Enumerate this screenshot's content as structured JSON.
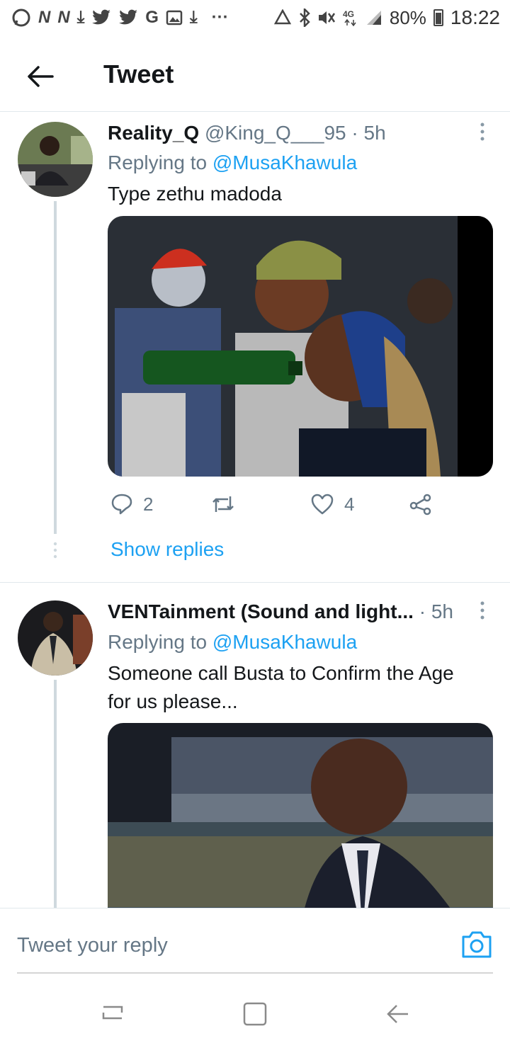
{
  "status_bar": {
    "left_icons": [
      "whatsapp-icon",
      "news-icon",
      "news-icon",
      "download-icon",
      "twitter-icon",
      "twitter-icon",
      "google-icon",
      "gallery-icon",
      "download-icon",
      "more-dots-icon"
    ],
    "right_icons": [
      "recycle-icon",
      "bluetooth-icon",
      "mute-icon",
      "network-4g-icon",
      "signal-icon",
      "battery-icon"
    ],
    "battery": "80%",
    "battery_level": 0.8,
    "time": "18:22"
  },
  "header": {
    "title": "Tweet"
  },
  "tweets": [
    {
      "name": "Reality_Q",
      "handle": "@King_Q___95",
      "dot": "·",
      "time": "5h",
      "replying_prefix": "Replying to ",
      "replying_to": "@MusaKhawula",
      "text": "Type zethu madoda",
      "replies": "2",
      "likes": "4",
      "show_replies": "Show replies"
    },
    {
      "name": "VENTainment (Sound and light...",
      "dot": "·",
      "time": "5h",
      "replying_prefix": "Replying to ",
      "replying_to": "@MusaKhawula",
      "text": "Someone call Busta to Confirm the Age for us please..."
    }
  ],
  "composer": {
    "placeholder": "Tweet your reply"
  },
  "colors": {
    "accent": "#1da1f2",
    "secondary_text": "#657786",
    "divider": "#e1e8ed"
  }
}
